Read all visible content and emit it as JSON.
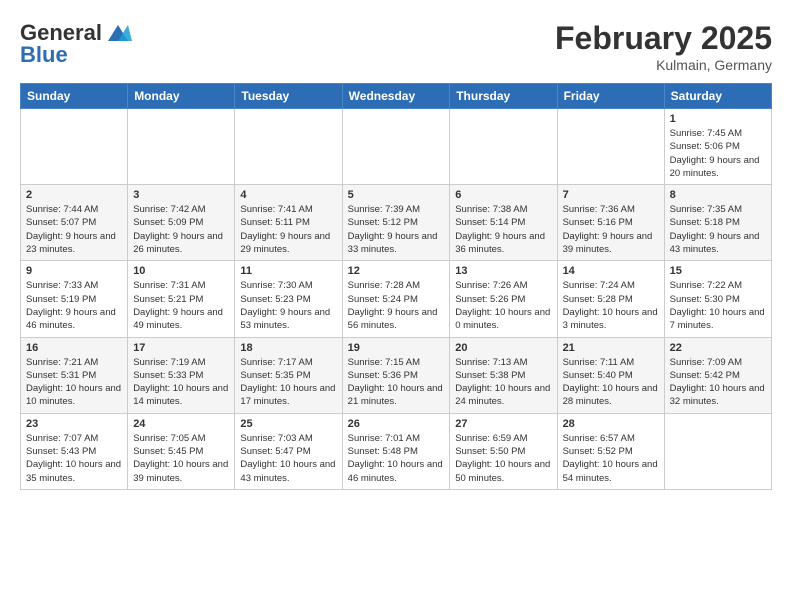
{
  "header": {
    "logo_line1": "General",
    "logo_line2": "Blue",
    "month": "February 2025",
    "location": "Kulmain, Germany"
  },
  "weekdays": [
    "Sunday",
    "Monday",
    "Tuesday",
    "Wednesday",
    "Thursday",
    "Friday",
    "Saturday"
  ],
  "weeks": [
    [
      {
        "day": "",
        "info": ""
      },
      {
        "day": "",
        "info": ""
      },
      {
        "day": "",
        "info": ""
      },
      {
        "day": "",
        "info": ""
      },
      {
        "day": "",
        "info": ""
      },
      {
        "day": "",
        "info": ""
      },
      {
        "day": "1",
        "info": "Sunrise: 7:45 AM\nSunset: 5:06 PM\nDaylight: 9 hours and 20 minutes."
      }
    ],
    [
      {
        "day": "2",
        "info": "Sunrise: 7:44 AM\nSunset: 5:07 PM\nDaylight: 9 hours and 23 minutes."
      },
      {
        "day": "3",
        "info": "Sunrise: 7:42 AM\nSunset: 5:09 PM\nDaylight: 9 hours and 26 minutes."
      },
      {
        "day": "4",
        "info": "Sunrise: 7:41 AM\nSunset: 5:11 PM\nDaylight: 9 hours and 29 minutes."
      },
      {
        "day": "5",
        "info": "Sunrise: 7:39 AM\nSunset: 5:12 PM\nDaylight: 9 hours and 33 minutes."
      },
      {
        "day": "6",
        "info": "Sunrise: 7:38 AM\nSunset: 5:14 PM\nDaylight: 9 hours and 36 minutes."
      },
      {
        "day": "7",
        "info": "Sunrise: 7:36 AM\nSunset: 5:16 PM\nDaylight: 9 hours and 39 minutes."
      },
      {
        "day": "8",
        "info": "Sunrise: 7:35 AM\nSunset: 5:18 PM\nDaylight: 9 hours and 43 minutes."
      }
    ],
    [
      {
        "day": "9",
        "info": "Sunrise: 7:33 AM\nSunset: 5:19 PM\nDaylight: 9 hours and 46 minutes."
      },
      {
        "day": "10",
        "info": "Sunrise: 7:31 AM\nSunset: 5:21 PM\nDaylight: 9 hours and 49 minutes."
      },
      {
        "day": "11",
        "info": "Sunrise: 7:30 AM\nSunset: 5:23 PM\nDaylight: 9 hours and 53 minutes."
      },
      {
        "day": "12",
        "info": "Sunrise: 7:28 AM\nSunset: 5:24 PM\nDaylight: 9 hours and 56 minutes."
      },
      {
        "day": "13",
        "info": "Sunrise: 7:26 AM\nSunset: 5:26 PM\nDaylight: 10 hours and 0 minutes."
      },
      {
        "day": "14",
        "info": "Sunrise: 7:24 AM\nSunset: 5:28 PM\nDaylight: 10 hours and 3 minutes."
      },
      {
        "day": "15",
        "info": "Sunrise: 7:22 AM\nSunset: 5:30 PM\nDaylight: 10 hours and 7 minutes."
      }
    ],
    [
      {
        "day": "16",
        "info": "Sunrise: 7:21 AM\nSunset: 5:31 PM\nDaylight: 10 hours and 10 minutes."
      },
      {
        "day": "17",
        "info": "Sunrise: 7:19 AM\nSunset: 5:33 PM\nDaylight: 10 hours and 14 minutes."
      },
      {
        "day": "18",
        "info": "Sunrise: 7:17 AM\nSunset: 5:35 PM\nDaylight: 10 hours and 17 minutes."
      },
      {
        "day": "19",
        "info": "Sunrise: 7:15 AM\nSunset: 5:36 PM\nDaylight: 10 hours and 21 minutes."
      },
      {
        "day": "20",
        "info": "Sunrise: 7:13 AM\nSunset: 5:38 PM\nDaylight: 10 hours and 24 minutes."
      },
      {
        "day": "21",
        "info": "Sunrise: 7:11 AM\nSunset: 5:40 PM\nDaylight: 10 hours and 28 minutes."
      },
      {
        "day": "22",
        "info": "Sunrise: 7:09 AM\nSunset: 5:42 PM\nDaylight: 10 hours and 32 minutes."
      }
    ],
    [
      {
        "day": "23",
        "info": "Sunrise: 7:07 AM\nSunset: 5:43 PM\nDaylight: 10 hours and 35 minutes."
      },
      {
        "day": "24",
        "info": "Sunrise: 7:05 AM\nSunset: 5:45 PM\nDaylight: 10 hours and 39 minutes."
      },
      {
        "day": "25",
        "info": "Sunrise: 7:03 AM\nSunset: 5:47 PM\nDaylight: 10 hours and 43 minutes."
      },
      {
        "day": "26",
        "info": "Sunrise: 7:01 AM\nSunset: 5:48 PM\nDaylight: 10 hours and 46 minutes."
      },
      {
        "day": "27",
        "info": "Sunrise: 6:59 AM\nSunset: 5:50 PM\nDaylight: 10 hours and 50 minutes."
      },
      {
        "day": "28",
        "info": "Sunrise: 6:57 AM\nSunset: 5:52 PM\nDaylight: 10 hours and 54 minutes."
      },
      {
        "day": "",
        "info": ""
      }
    ]
  ]
}
